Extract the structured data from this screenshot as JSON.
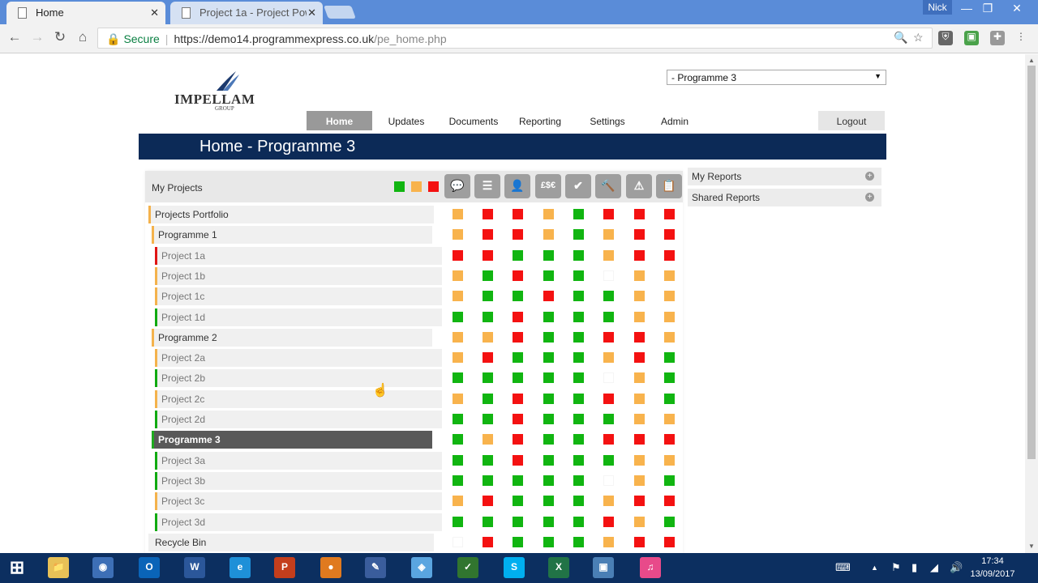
{
  "browser": {
    "tabs": [
      {
        "label": "Home",
        "close": "✕"
      },
      {
        "label": "Project 1a - Project Powe",
        "close": "✕"
      }
    ],
    "user": "Nick",
    "window_controls": {
      "minimize": "—",
      "restore": "❐",
      "close": "✕"
    },
    "url": {
      "secure_label": "Secure",
      "host": "https://demo14.programmexpress.co.uk",
      "path": "/pe_home.php"
    }
  },
  "header": {
    "logo_name": "IMPELLAM",
    "logo_sub": "GROUP",
    "programme_select": "- Programme 3",
    "menu": [
      "Home",
      "Updates",
      "Documents",
      "Reporting",
      "Settings",
      "Admin"
    ],
    "active_menu": "Home",
    "logout": "Logout",
    "page_title": "Home - Programme 3"
  },
  "projects": {
    "title": "My Projects",
    "legend": [
      "#11b511",
      "#f8b34d",
      "#f41111"
    ],
    "column_icons": [
      {
        "icon": "comment-icon",
        "glyph": "💬"
      },
      {
        "icon": "gantt-icon",
        "glyph": "☰"
      },
      {
        "icon": "user-icon",
        "glyph": "👤"
      },
      {
        "icon": "currency-icon",
        "glyph": "£$€"
      },
      {
        "icon": "check-icon",
        "glyph": "✔"
      },
      {
        "icon": "hammer-icon",
        "glyph": "🔨"
      },
      {
        "icon": "warning-icon",
        "glyph": "⚠"
      },
      {
        "icon": "documents-icon",
        "glyph": "📋"
      }
    ],
    "rows": [
      {
        "label": "Projects Portfolio",
        "level": 0,
        "bar": "amber",
        "status": [
          "a",
          "r",
          "r",
          "a",
          "g",
          "r",
          "r",
          "r"
        ]
      },
      {
        "label": "Programme 1",
        "level": 1,
        "bar": "amber",
        "status": [
          "a",
          "r",
          "r",
          "a",
          "g",
          "a",
          "r",
          "r"
        ]
      },
      {
        "label": "Project 1a",
        "level": 2,
        "bar": "red",
        "status": [
          "r",
          "r",
          "g",
          "g",
          "g",
          "a",
          "r",
          "r"
        ]
      },
      {
        "label": "Project 1b",
        "level": 2,
        "bar": "amber",
        "status": [
          "a",
          "g",
          "r",
          "g",
          "g",
          "n",
          "a",
          "a"
        ]
      },
      {
        "label": "Project 1c",
        "level": 2,
        "bar": "amber",
        "status": [
          "a",
          "g",
          "g",
          "r",
          "g",
          "g",
          "a",
          "a"
        ]
      },
      {
        "label": "Project 1d",
        "level": 2,
        "bar": "green",
        "status": [
          "g",
          "g",
          "r",
          "g",
          "g",
          "g",
          "a",
          "a"
        ]
      },
      {
        "label": "Programme 2",
        "level": 1,
        "bar": "amber",
        "status": [
          "a",
          "a",
          "r",
          "g",
          "g",
          "r",
          "r",
          "a"
        ]
      },
      {
        "label": "Project 2a",
        "level": 2,
        "bar": "amber",
        "status": [
          "a",
          "r",
          "g",
          "g",
          "g",
          "a",
          "r",
          "g"
        ]
      },
      {
        "label": "Project 2b",
        "level": 2,
        "bar": "green",
        "status": [
          "g",
          "g",
          "g",
          "g",
          "g",
          "n",
          "a",
          "g"
        ]
      },
      {
        "label": "Project 2c",
        "level": 2,
        "bar": "amber",
        "status": [
          "a",
          "g",
          "r",
          "g",
          "g",
          "r",
          "a",
          "g"
        ]
      },
      {
        "label": "Project 2d",
        "level": 2,
        "bar": "green",
        "status": [
          "g",
          "g",
          "r",
          "g",
          "g",
          "g",
          "a",
          "a"
        ]
      },
      {
        "label": "Programme 3",
        "level": 1,
        "bar": "green",
        "selected": true,
        "status": [
          "g",
          "a",
          "r",
          "g",
          "g",
          "r",
          "r",
          "r"
        ]
      },
      {
        "label": "Project 3a",
        "level": 2,
        "bar": "green",
        "status": [
          "g",
          "g",
          "r",
          "g",
          "g",
          "g",
          "a",
          "a"
        ]
      },
      {
        "label": "Project 3b",
        "level": 2,
        "bar": "green",
        "status": [
          "g",
          "g",
          "g",
          "g",
          "g",
          "n",
          "a",
          "g"
        ]
      },
      {
        "label": "Project 3c",
        "level": 2,
        "bar": "amber",
        "status": [
          "a",
          "r",
          "g",
          "g",
          "g",
          "a",
          "r",
          "r"
        ]
      },
      {
        "label": "Project 3d",
        "level": 2,
        "bar": "green",
        "status": [
          "g",
          "g",
          "g",
          "g",
          "g",
          "r",
          "a",
          "g"
        ]
      },
      {
        "label": "Recycle Bin",
        "level": 0,
        "bar": "none",
        "status": [
          "n",
          "r",
          "g",
          "g",
          "g",
          "a",
          "r",
          "r"
        ]
      }
    ]
  },
  "side_panels": [
    {
      "label": "My Reports",
      "icon": "+"
    },
    {
      "label": "Shared Reports",
      "icon": "+"
    }
  ],
  "taskbar": {
    "apps": [
      {
        "name": "start-icon",
        "glyph": "⊞",
        "color": "#0c2f60"
      },
      {
        "name": "file-explorer-icon",
        "glyph": "📁",
        "color": "#e8c157"
      },
      {
        "name": "chrome-icon",
        "glyph": "◉",
        "color": "#3d6fb6"
      },
      {
        "name": "outlook-icon",
        "glyph": "O",
        "color": "#0a64b8"
      },
      {
        "name": "word-icon",
        "glyph": "W",
        "color": "#2b579a"
      },
      {
        "name": "internet-explorer-icon",
        "glyph": "e",
        "color": "#1e90d8"
      },
      {
        "name": "powerpoint-icon",
        "glyph": "P",
        "color": "#c43e1c"
      },
      {
        "name": "lync-icon",
        "glyph": "●",
        "color": "#e07a1f"
      },
      {
        "name": "visio-icon",
        "glyph": "✎",
        "color": "#3a5d9c"
      },
      {
        "name": "security-app-icon",
        "glyph": "◈",
        "color": "#5aa5e0"
      },
      {
        "name": "project-icon",
        "glyph": "✓",
        "color": "#31752f"
      },
      {
        "name": "skype-icon",
        "glyph": "S",
        "color": "#00aff0"
      },
      {
        "name": "excel-icon",
        "glyph": "X",
        "color": "#217346"
      },
      {
        "name": "remote-desktop-icon",
        "glyph": "▣",
        "color": "#4a7fb5"
      },
      {
        "name": "itunes-icon",
        "glyph": "♫",
        "color": "#e84a8a"
      }
    ],
    "time": "17:34",
    "date": "13/09/2017"
  }
}
